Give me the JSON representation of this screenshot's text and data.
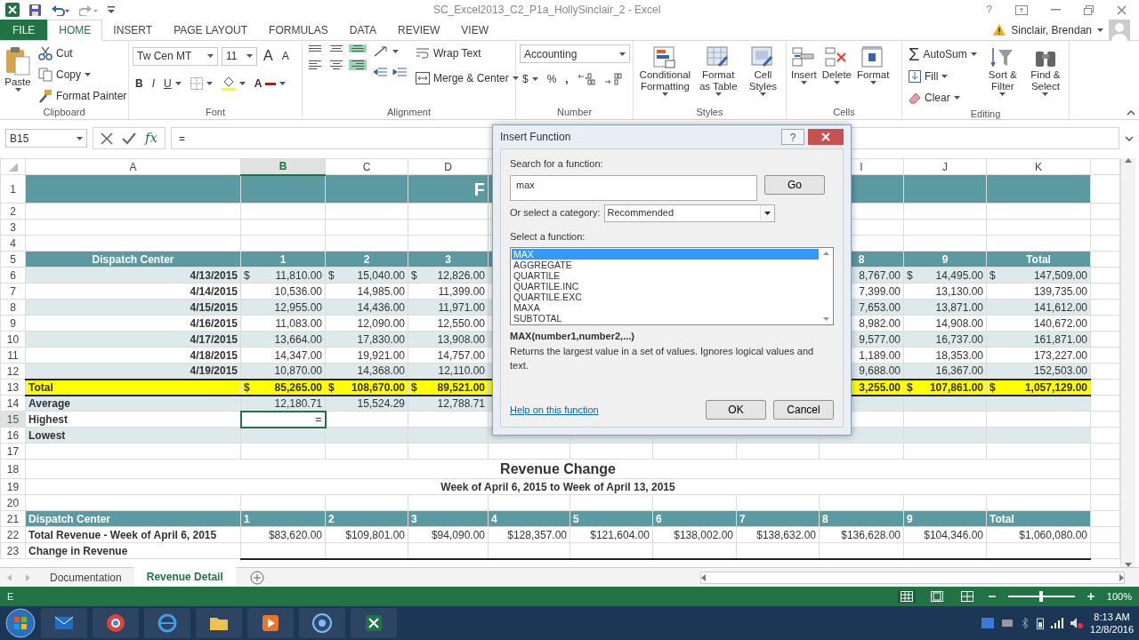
{
  "window": {
    "title": "SC_Excel2013_C2_P1a_HollySinclair_2 - Excel",
    "help": "?"
  },
  "account": {
    "user": "Sinclair, Brendan"
  },
  "ribbon_tabs": [
    {
      "label": "FILE",
      "kind": "file",
      "selected": false
    },
    {
      "label": "HOME",
      "kind": "tab",
      "selected": true
    },
    {
      "label": "INSERT",
      "kind": "tab",
      "selected": false
    },
    {
      "label": "PAGE LAYOUT",
      "kind": "tab",
      "selected": false
    },
    {
      "label": "FORMULAS",
      "kind": "tab",
      "selected": false
    },
    {
      "label": "DATA",
      "kind": "tab",
      "selected": false
    },
    {
      "label": "REVIEW",
      "kind": "tab",
      "selected": false
    },
    {
      "label": "VIEW",
      "kind": "tab",
      "selected": false
    }
  ],
  "ribbon": {
    "clipboard": {
      "label": "Clipboard",
      "paste": "Paste",
      "cut": "Cut",
      "copy": "Copy",
      "format_painter": "Format Painter"
    },
    "font": {
      "label": "Font",
      "font_name": "Tw Cen MT",
      "font_size": "11",
      "grow_font": "A",
      "shrink_font": "A",
      "bold": "B",
      "italic": "I",
      "underline": "U",
      "font_color": "A"
    },
    "alignment": {
      "label": "Alignment",
      "toggles": [
        {
          "selected": false
        },
        {
          "selected": false
        },
        {
          "selected": true
        },
        {
          "selected": false
        },
        {
          "selected": false
        },
        {
          "selected": true
        }
      ],
      "wrap_text": "Wrap Text",
      "merge": "Merge & Center"
    },
    "number": {
      "label": "Number",
      "format": "Accounting",
      "currency": "$",
      "percent": "%",
      "comma": ","
    },
    "styles": {
      "label": "Styles",
      "buttons": [
        "Conditional Formatting",
        "Format as Table",
        "Cell Styles"
      ]
    },
    "cells": {
      "label": "Cells",
      "buttons": [
        "Insert",
        "Delete",
        "Format"
      ]
    },
    "editing": {
      "label": "Editing",
      "autosum_symbol": "Σ",
      "autosum": "AutoSum",
      "fill": "Fill",
      "clear": "Clear",
      "sort": "Sort & Filter",
      "find": "Find & Select"
    }
  },
  "formula_bar": {
    "name_box": "B15",
    "function_button": "fx",
    "formula": "="
  },
  "sheet": {
    "columns": [
      {
        "letter": "A",
        "selected": false
      },
      {
        "letter": "B",
        "selected": true
      },
      {
        "letter": "C",
        "selected": false
      },
      {
        "letter": "D",
        "selected": false
      },
      null,
      null,
      null,
      null,
      {
        "letter": "I",
        "selected": false
      },
      {
        "letter": "J",
        "selected": false
      },
      {
        "letter": "K",
        "selected": false
      }
    ],
    "rows": [
      {
        "number": "1",
        "kind": "banner",
        "selected": false,
        "cells": [
          null,
          null,
          null,
          "F"
        ]
      },
      {
        "number": "2",
        "kind": "blank",
        "selected": false
      },
      {
        "number": "3",
        "kind": "blank",
        "selected": false
      },
      {
        "number": "4",
        "kind": "blank",
        "selected": false
      },
      {
        "number": "5",
        "kind": "header",
        "selected": false,
        "cells": [
          "Dispatch Center",
          "1",
          "2",
          "3",
          null,
          null,
          null,
          null,
          "8",
          "9",
          "Total"
        ]
      },
      {
        "number": "6",
        "kind": "data",
        "shaded": true,
        "selected": false,
        "cells": [
          "4/13/2015",
          {
            "symbol": "$",
            "text": "11,810.00"
          },
          {
            "symbol": "$",
            "text": "15,040.00"
          },
          {
            "symbol": "$",
            "text": "12,826.00"
          },
          null,
          null,
          null,
          null,
          "8,767.00",
          {
            "symbol": "$",
            "text": "14,495.00"
          },
          {
            "symbol": "$",
            "text": "147,509.00"
          }
        ]
      },
      {
        "number": "7",
        "kind": "data",
        "shaded": false,
        "selected": false,
        "cells": [
          "4/14/2015",
          "10,536.00",
          "14,985.00",
          "11,399.00",
          null,
          null,
          null,
          null,
          "7,399.00",
          "13,130.00",
          "139,735.00"
        ]
      },
      {
        "number": "8",
        "kind": "data",
        "shaded": true,
        "selected": false,
        "cells": [
          "4/15/2015",
          "12,955.00",
          "14,436.00",
          "11,971.00",
          null,
          null,
          null,
          null,
          "7,653.00",
          "13,871.00",
          "141,612.00"
        ]
      },
      {
        "number": "9",
        "kind": "data",
        "shaded": false,
        "selected": false,
        "cells": [
          "4/16/2015",
          "11,083.00",
          "12,090.00",
          "12,550.00",
          null,
          null,
          null,
          null,
          "8,982.00",
          "14,908.00",
          "140,672.00"
        ]
      },
      {
        "number": "10",
        "kind": "data",
        "shaded": true,
        "selected": false,
        "cells": [
          "4/17/2015",
          "13,664.00",
          "17,830.00",
          "13,908.00",
          null,
          null,
          null,
          null,
          "9,577.00",
          "16,737.00",
          "161,871.00"
        ]
      },
      {
        "number": "11",
        "kind": "data",
        "shaded": false,
        "selected": false,
        "cells": [
          "4/18/2015",
          "14,347.00",
          "19,921.00",
          "14,757.00",
          null,
          null,
          null,
          null,
          "1,189.00",
          "18,353.00",
          "173,227.00"
        ]
      },
      {
        "number": "12",
        "kind": "data",
        "shaded": true,
        "selected": false,
        "cells": [
          "4/19/2015",
          "10,870.00",
          "14,368.00",
          "12,110.00",
          null,
          null,
          null,
          null,
          "9,688.00",
          "16,367.00",
          "152,503.00"
        ]
      },
      {
        "number": "13",
        "kind": "total",
        "selected": false,
        "cells": [
          "Total",
          {
            "symbol": "$",
            "text": "85,265.00"
          },
          {
            "symbol": "$",
            "text": "108,670.00"
          },
          {
            "symbol": "$",
            "text": "89,521.00"
          },
          null,
          null,
          null,
          null,
          "3,255.00",
          {
            "symbol": "$",
            "text": "107,861.00"
          },
          {
            "symbol": "$",
            "text": "1,057,129.00"
          }
        ]
      },
      {
        "number": "14",
        "kind": "summary",
        "shaded": true,
        "selected": false,
        "cells": [
          "Average",
          "12,180.71",
          "15,524.29",
          "12,788.71"
        ]
      },
      {
        "number": "15",
        "kind": "summary",
        "shaded": false,
        "selected": true,
        "cells": [
          "Highest",
          {
            "text": "=",
            "active": true
          }
        ]
      },
      {
        "number": "16",
        "kind": "summary",
        "shaded": true,
        "selected": false,
        "cells": [
          "Lowest"
        ]
      },
      {
        "number": "17",
        "kind": "blank",
        "selected": false
      },
      {
        "number": "18",
        "kind": "heading",
        "selected": false,
        "text": "Revenue Change"
      },
      {
        "number": "19",
        "kind": "subheading",
        "selected": false,
        "text": "Week of April 6, 2015 to Week of April 13, 2015"
      },
      {
        "number": "20",
        "kind": "blank",
        "selected": false
      },
      {
        "number": "21",
        "kind": "header2",
        "selected": false,
        "cells": [
          "Dispatch Center",
          "1",
          "2",
          "3",
          "4",
          "5",
          "6",
          "7",
          "8",
          "9",
          "Total"
        ]
      },
      {
        "number": "22",
        "kind": "plain",
        "selected": false,
        "cells": [
          "Total Revenue - Week of April 6, 2015",
          "$83,620.00",
          "$109,801.00",
          "$94,090.00",
          "$128,357.00",
          "$121,604.00",
          "$138,002.00",
          "$138,632.00",
          "$136,628.00",
          "$104,346.00",
          "$1,060,080.00"
        ]
      },
      {
        "number": "23",
        "kind": "ruled",
        "selected": false,
        "cells": [
          "Change in  Revenue"
        ]
      }
    ]
  },
  "dialog": {
    "title": "Insert Function",
    "help": "?",
    "search_label": "Search for a function:",
    "search_value": "max",
    "go": "Go",
    "category_label": "Or select a category:",
    "category": "Recommended",
    "list_label": "Select a function:",
    "functions": [
      {
        "name": "MAX",
        "selected": true
      },
      {
        "name": "AGGREGATE",
        "selected": false
      },
      {
        "name": "QUARTILE",
        "selected": false
      },
      {
        "name": "QUARTILE.INC",
        "selected": false
      },
      {
        "name": "QUARTILE.EXC",
        "selected": false
      },
      {
        "name": "MAXA",
        "selected": false
      },
      {
        "name": "SUBTOTAL",
        "selected": false
      }
    ],
    "signature": "MAX(number1,number2,...)",
    "description": "Returns the largest value in a set of values. Ignores logical values and text.",
    "help_link": "Help on this function",
    "ok": "OK",
    "cancel": "Cancel"
  },
  "sheet_tabs": [
    {
      "label": "Documentation",
      "selected": false
    },
    {
      "label": "Revenue Detail",
      "selected": true
    }
  ],
  "status_bar": {
    "mode": "E",
    "views": [
      {
        "selected": true
      },
      {
        "selected": false
      },
      {
        "selected": false
      }
    ],
    "zoom_slider": {
      "level": 0.5
    },
    "zoom": "100%"
  },
  "taskbar": {
    "time": "8:13 AM",
    "date": "12/8/2016"
  }
}
